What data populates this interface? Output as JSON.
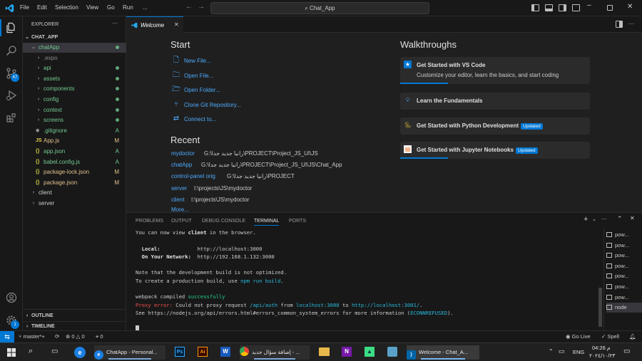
{
  "titlebar": {
    "menu": [
      "File",
      "Edit",
      "Selection",
      "View",
      "Go",
      "Run",
      "..."
    ],
    "search": "Chat_App"
  },
  "activity": {
    "scm_badge": "47",
    "accounts_badge": "1"
  },
  "sidebar": {
    "header": "EXPLORER",
    "root": "CHAT_APP",
    "items": [
      {
        "label": "chatApp",
        "depth": 1,
        "type": "folder",
        "open": true,
        "status": "dot",
        "color": "#73c991"
      },
      {
        "label": ".expo",
        "depth": 2,
        "type": "folder",
        "status": "",
        "color": "#8c8c8c"
      },
      {
        "label": "api",
        "depth": 2,
        "type": "folder",
        "status": "dot",
        "color": "#73c991"
      },
      {
        "label": "assets",
        "depth": 2,
        "type": "folder",
        "status": "dot",
        "color": "#73c991"
      },
      {
        "label": "components",
        "depth": 2,
        "type": "folder",
        "status": "dot",
        "color": "#73c991"
      },
      {
        "label": "config",
        "depth": 2,
        "type": "folder",
        "status": "dot",
        "color": "#73c991"
      },
      {
        "label": "context",
        "depth": 2,
        "type": "folder",
        "status": "dot",
        "color": "#73c991"
      },
      {
        "label": "screens",
        "depth": 2,
        "type": "folder",
        "status": "dot",
        "color": "#73c991"
      },
      {
        "label": ".gitignore",
        "depth": 2,
        "type": "git",
        "status": "A",
        "color": "#73c991"
      },
      {
        "label": "App.js",
        "depth": 2,
        "type": "js",
        "status": "M",
        "color": "#e2c08d"
      },
      {
        "label": "app.json",
        "depth": 2,
        "type": "json",
        "status": "A",
        "color": "#73c991"
      },
      {
        "label": "babel.config.js",
        "depth": 2,
        "type": "json",
        "status": "A",
        "color": "#73c991"
      },
      {
        "label": "package-lock.json",
        "depth": 2,
        "type": "json",
        "status": "M",
        "color": "#e2c08d"
      },
      {
        "label": "package.json",
        "depth": 2,
        "type": "json",
        "status": "M",
        "color": "#e2c08d"
      },
      {
        "label": "client",
        "depth": 1,
        "type": "folder",
        "status": "",
        "color": "#cccccc"
      },
      {
        "label": "server",
        "depth": 1,
        "type": "folder",
        "status": "",
        "color": "#cccccc"
      }
    ],
    "outline": "OUTLINE",
    "timeline": "TIMELINE"
  },
  "editor": {
    "tab_label": "Welcome",
    "start_heading": "Start",
    "start_items": [
      {
        "label": "New File...",
        "icon": "new-file"
      },
      {
        "label": "Open File...",
        "icon": "open-file"
      },
      {
        "label": "Open Folder...",
        "icon": "open-folder"
      },
      {
        "label": "Clone Git Repository...",
        "icon": "git-clone"
      },
      {
        "label": "Connect to...",
        "icon": "remote"
      }
    ],
    "recent_heading": "Recent",
    "recent": [
      {
        "name": "mydoctor",
        "path": "G:\\رانيا جديد جدا\\PROJECT\\Project_JS_UI\\JS"
      },
      {
        "name": "chatApp",
        "path": "G:\\رانيا جديد جدا\\PROJECT\\Project_JS_UI\\JS\\Chat_App"
      },
      {
        "name": "control-panel orig",
        "path": "G:\\رانيا جديد جدا\\PROJECT"
      },
      {
        "name": "server",
        "path": "I:\\projects\\JS\\mydoctor"
      },
      {
        "name": "client",
        "path": "I:\\projects\\JS\\mydoctor"
      }
    ],
    "more": "More...",
    "walkthroughs_heading": "Walkthroughs",
    "walkthroughs": [
      {
        "title": "Get Started with VS Code",
        "desc": "Customize your editor, learn the basics, and start coding",
        "badge": "",
        "progress": 0.25
      },
      {
        "title": "Learn the Fundamentals",
        "desc": "",
        "badge": "",
        "progress": 0
      },
      {
        "title": "Get Started with Python Development",
        "desc": "",
        "badge": "Updated",
        "progress": 0
      },
      {
        "title": "Get Started with Jupyter Notebooks",
        "desc": "",
        "badge": "Updated",
        "progress": 0.25
      }
    ]
  },
  "panel": {
    "tabs": [
      "PROBLEMS",
      "OUTPUT",
      "DEBUG CONSOLE",
      "TERMINAL",
      "PORTS"
    ],
    "active_tab": "TERMINAL",
    "terminal": {
      "line1_a": "You can now view ",
      "line1_b": "client",
      "line1_c": " in the browser.",
      "local_label": "Local:",
      "local_url": "http://localhost:3000",
      "network_label": "On Your Network:",
      "network_url": "http://192.168.1.132:3000",
      "note1": "Note that the development build is not optimized.",
      "note2_a": "To create a production build, use ",
      "note2_b": "npm run build",
      "note2_c": ".",
      "compiled_a": "webpack compiled ",
      "compiled_b": "successfully",
      "proxy_a": "Proxy error:",
      "proxy_b": " Could not proxy request ",
      "proxy_c": "/api/auth",
      "proxy_d": " from ",
      "proxy_e": "localhost:3000",
      "proxy_f": " to ",
      "proxy_g": "http://localhost:3001/",
      "proxy_h": ".",
      "see_a": "See https://nodejs.org/api/errors.html#errors_common_system_errors for more information (",
      "see_b": "ECONNREFUSED",
      "see_c": ")."
    },
    "terminals": [
      "pow...",
      "pow...",
      "pow...",
      "pow...",
      "pow...",
      "pow...",
      "pow...",
      "node"
    ]
  },
  "statusbar": {
    "branch": "master*+",
    "errors": "0",
    "warnings": "0",
    "ports": "0",
    "golive": "Go Live",
    "spell": "Spell"
  },
  "taskbar": {
    "apps": [
      {
        "label": "ChatApp - Personal...",
        "icon": "edge"
      },
      {
        "label": "إضافة سؤال جديد - ...",
        "icon": "chrome"
      },
      {
        "label": "Welcome - Chat_A...",
        "icon": "vscode"
      }
    ],
    "lang": "ENG",
    "time": "04:26 م",
    "date": "٢٠٢٤/١٠/٢٣"
  }
}
